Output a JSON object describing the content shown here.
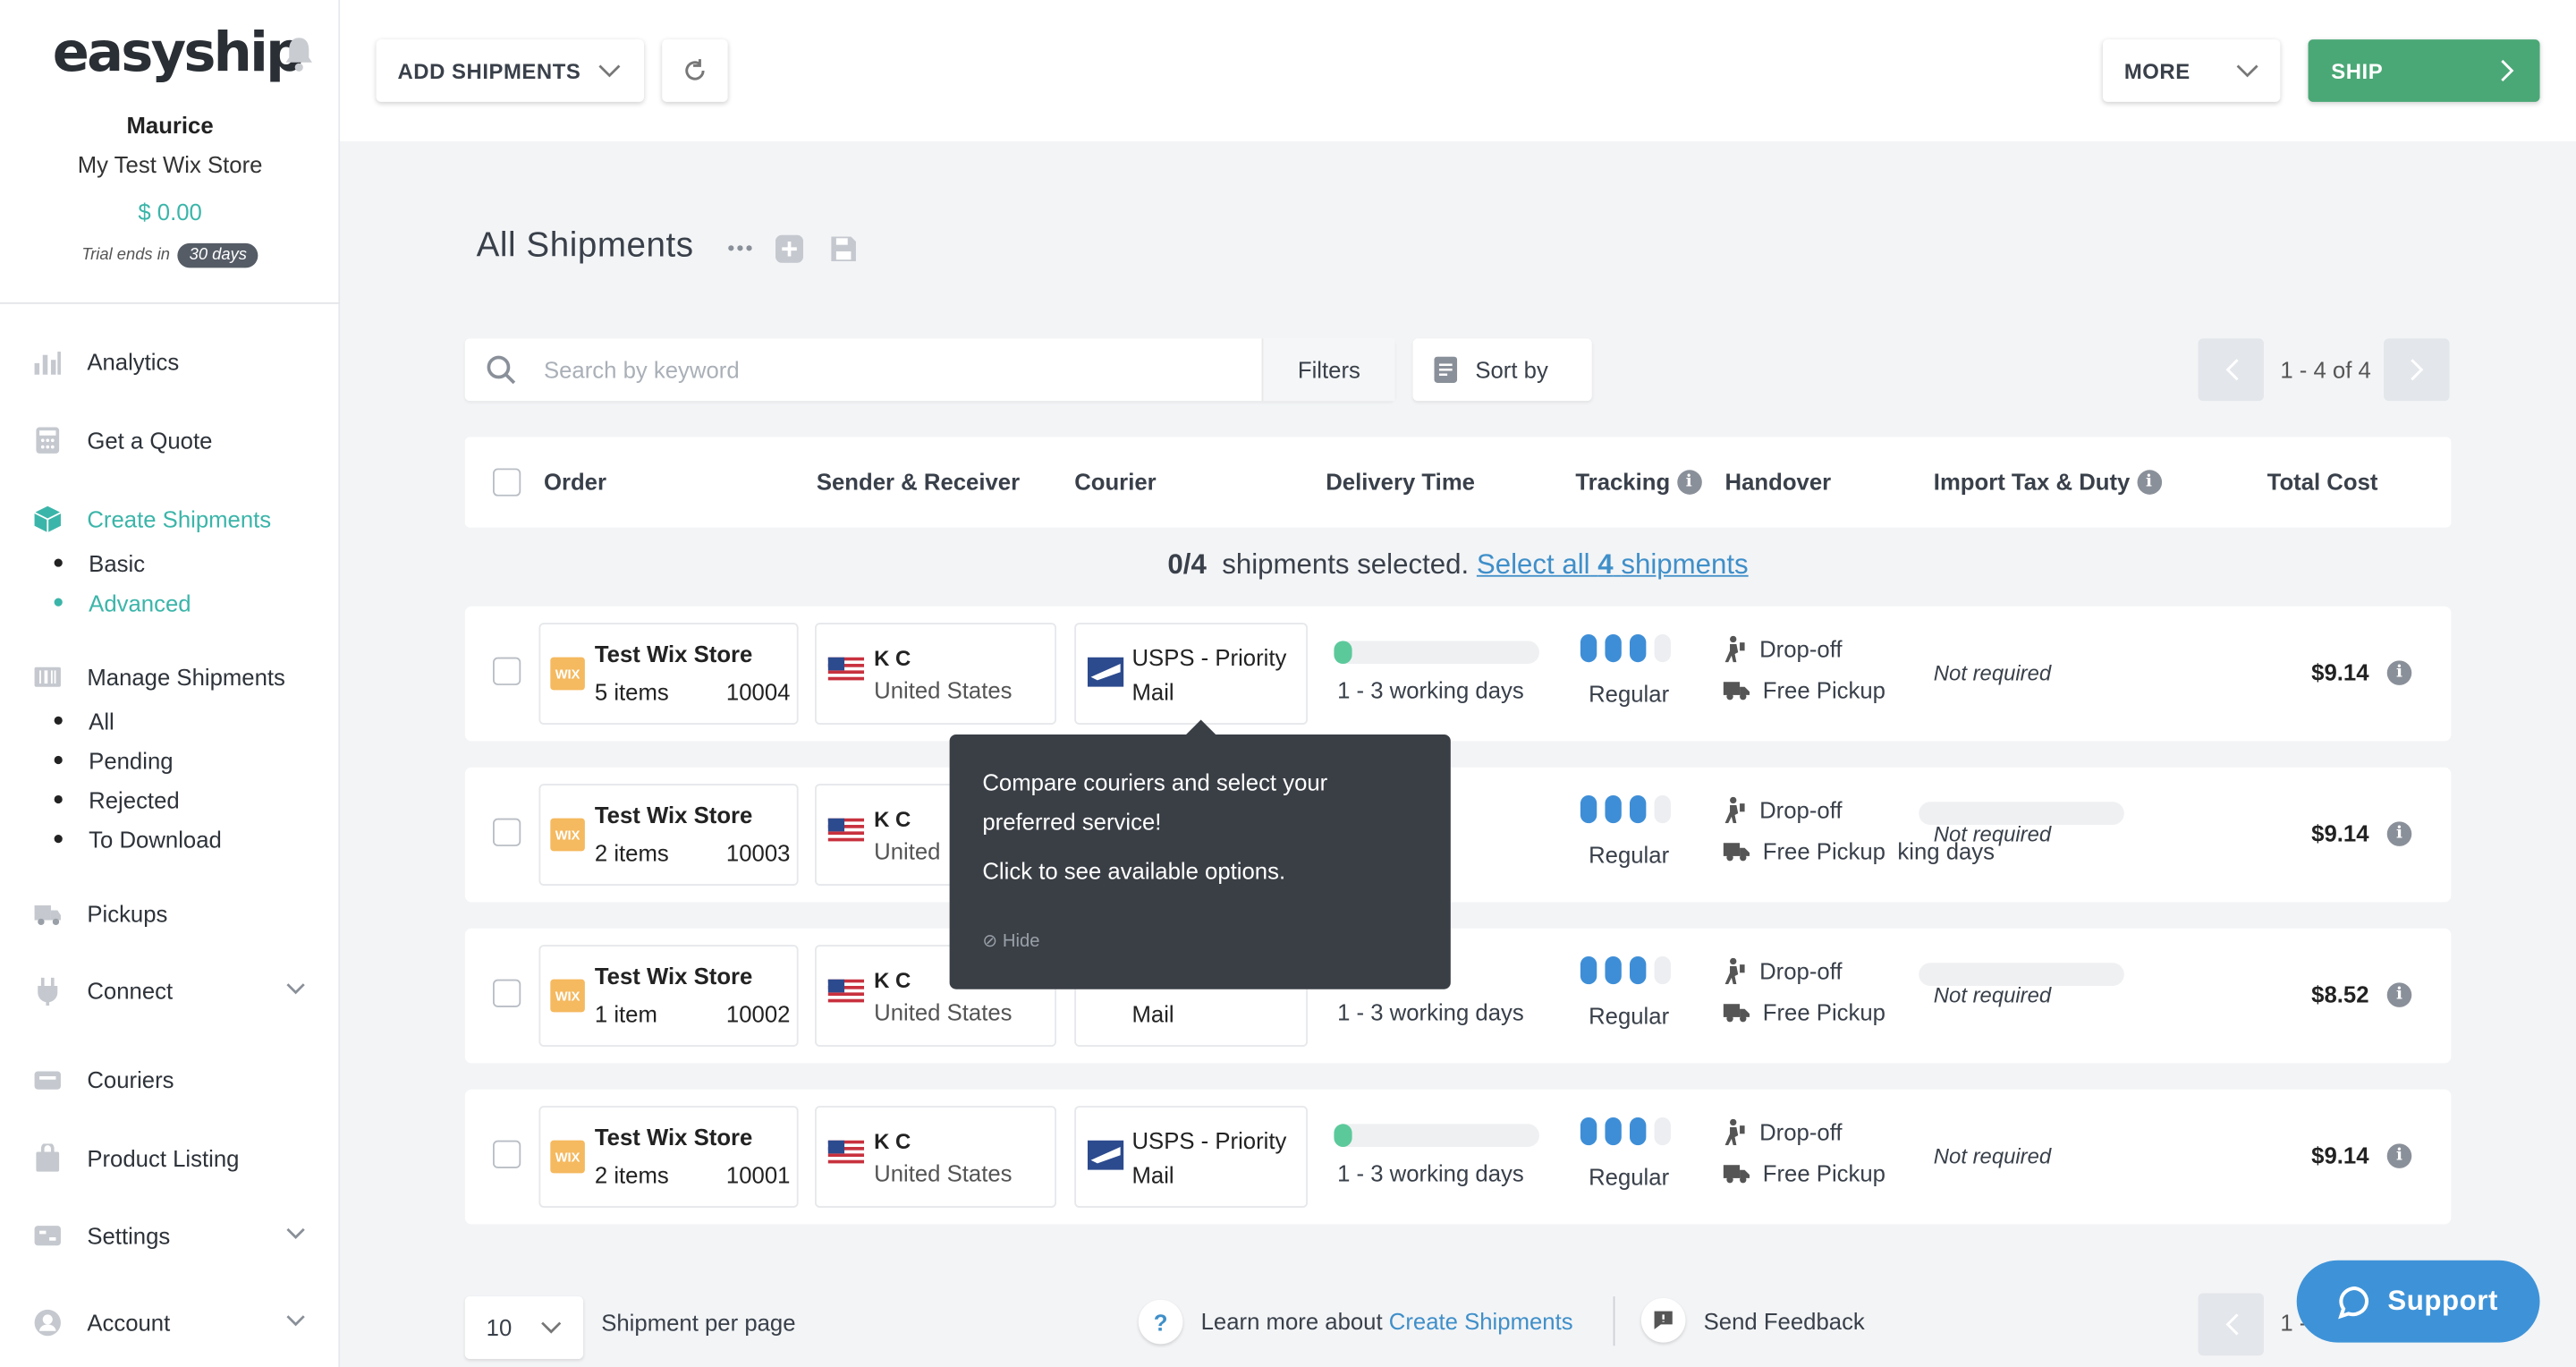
{
  "sidebar": {
    "logo": "easyship",
    "user_name": "Maurice",
    "store_name": "My Test Wix Store",
    "balance": "$ 0.00",
    "trial_prefix": "Trial ends in",
    "trial_days": "30 days",
    "nav": {
      "analytics": "Analytics",
      "quote": "Get a Quote",
      "create": "Create Shipments",
      "create_basic": "Basic",
      "create_advanced": "Advanced",
      "manage": "Manage Shipments",
      "manage_all": "All",
      "manage_pending": "Pending",
      "manage_rejected": "Rejected",
      "manage_download": "To Download",
      "pickups": "Pickups",
      "connect": "Connect",
      "couriers": "Couriers",
      "product_listing": "Product Listing",
      "settings": "Settings",
      "account": "Account"
    }
  },
  "topbar": {
    "add_shipments": "ADD SHIPMENTS",
    "more": "MORE",
    "ship": "SHIP"
  },
  "main": {
    "title": "All Shipments",
    "search_placeholder": "Search by keyword",
    "filters": "Filters",
    "sort_by": "Sort by",
    "pagination": "1 - 4 of 4",
    "pagination_bottom": "1 -",
    "selection": {
      "count": "0/4",
      "text": "shipments selected.",
      "select_all": "Select all",
      "select_all_num": "4",
      "select_all_suffix": "shipments"
    }
  },
  "table": {
    "headers": {
      "order": "Order",
      "sender_receiver": "Sender & Receiver",
      "courier": "Courier",
      "delivery_time": "Delivery Time",
      "tracking": "Tracking",
      "handover": "Handover",
      "import_tax": "Import Tax & Duty",
      "total_cost": "Total Cost"
    },
    "rows": [
      {
        "store": "Test Wix Store",
        "items": "5 items",
        "order_no": "10004",
        "receiver": "K C",
        "country": "United States",
        "courier_line1": "USPS - Priority",
        "courier_line2": "Mail",
        "delivery": "1 - 3 working days",
        "tracking": "Regular",
        "handover1": "Drop-off",
        "handover2": "Free Pickup",
        "tax": "Not required",
        "cost": "$9.14"
      },
      {
        "store": "Test Wix Store",
        "items": "2 items",
        "order_no": "10003",
        "receiver": "K C",
        "country": "United",
        "courier_line1": "",
        "courier_line2": "",
        "delivery": "king days",
        "tracking": "Regular",
        "handover1": "Drop-off",
        "handover2": "Free Pickup",
        "tax": "Not required",
        "cost": "$9.14"
      },
      {
        "store": "Test Wix Store",
        "items": "1 item",
        "order_no": "10002",
        "receiver": "K C",
        "country": "United States",
        "courier_line1": "",
        "courier_line2": "Mail",
        "delivery": "1 - 3 working days",
        "tracking": "Regular",
        "handover1": "Drop-off",
        "handover2": "Free Pickup",
        "tax": "Not required",
        "cost": "$8.52"
      },
      {
        "store": "Test Wix Store",
        "items": "2 items",
        "order_no": "10001",
        "receiver": "K C",
        "country": "United States",
        "courier_line1": "USPS - Priority",
        "courier_line2": "Mail",
        "delivery": "1 - 3 working days",
        "tracking": "Regular",
        "handover1": "Drop-off",
        "handover2": "Free Pickup",
        "tax": "Not required",
        "cost": "$9.14"
      }
    ]
  },
  "tooltip": {
    "line1": "Compare couriers and select your preferred service!",
    "line2": "Click to see available options.",
    "hide": "⊘ Hide"
  },
  "footer": {
    "per_page_value": "10",
    "per_page_label": "Shipment per page",
    "learn_more": "Learn more about",
    "learn_link": "Create Shipments",
    "feedback": "Send Feedback",
    "support": "Support"
  },
  "colors": {
    "accent": "#3bb5a9",
    "ship_green": "#4aa876",
    "link_blue": "#3f8fc9",
    "support_blue": "#3e93d8",
    "wix_orange": "#f5b95f"
  }
}
